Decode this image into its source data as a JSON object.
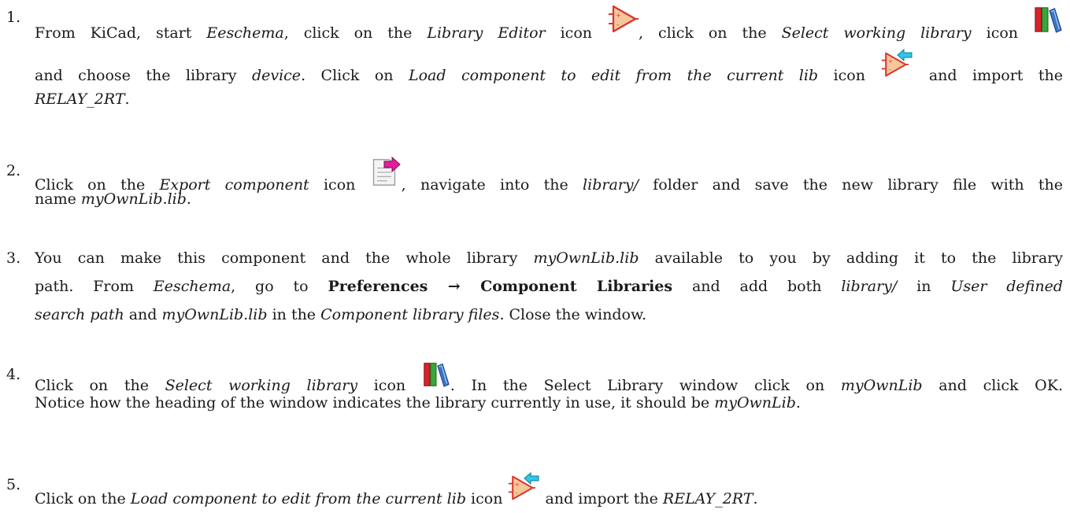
{
  "steps": [
    {
      "num": "1.",
      "t1": "From KiCad, start ",
      "eeschema": "Eeschema",
      "t2": ", click on the ",
      "library_editor": "Library Editor",
      "t3": " icon ",
      "t4": ", click on the ",
      "select_working_library": "Select working library",
      "t5": " icon",
      "t6": "and choose the library ",
      "device": "device",
      "t7": ". Click on ",
      "load_component": "Load component to edit from the current lib",
      "t8": " icon ",
      "t9": " and import the",
      "relay": "RELAY_2RT",
      "t10": "."
    },
    {
      "num": "2.",
      "t1": "Click on the ",
      "export_component": "Export component",
      "t2": " icon ",
      "t3": ", navigate into the ",
      "library_folder": "library/",
      "t4": " folder and save the new library file with the",
      "t5": "name ",
      "mylib": "myOwnLib.lib",
      "t6": "."
    },
    {
      "num": "3.",
      "t1": "You can make this component and the whole library ",
      "mylib": "myOwnLib.lib",
      "t2": " available to you by adding it to the library",
      "t3": "path. From ",
      "eeschema": "Eeschema",
      "t4": ", go to ",
      "menu_path": "Preferences → Component Libraries",
      "t5": " and add both ",
      "library_folder": "library/",
      "t6": " in ",
      "user_defined": "User defined",
      "search_path": "search path",
      "t7": " and ",
      "mylib2": "myOwnLib.lib",
      "t8": " in the ",
      "component_library_files": "Component library files",
      "t9": ". Close the window."
    },
    {
      "num": "4.",
      "t1": "Click on the ",
      "select_working_library": "Select working library",
      "t2": " icon ",
      "t3": ". In the Select Library window click on ",
      "mylib": "myOwnLib",
      "t4": " and click OK.",
      "t5": "Notice how the heading of the window indicates the library currently in use, it should be ",
      "mylib2": "myOwnLib",
      "t6": "."
    },
    {
      "num": "5.",
      "t1": "Click on the ",
      "load_component": "Load component to edit from the current lib",
      "t2": " icon ",
      "t3": " and import the ",
      "relay": "RELAY_2RT",
      "t4": "."
    }
  ],
  "icons": {
    "library_editor": "library-editor-icon",
    "select_working_library": "select-working-library-icon",
    "load_component": "load-component-icon",
    "export_component": "export-component-icon"
  },
  "colors": {
    "component_fill": "#f5c79a",
    "component_stroke": "#d9342b",
    "arrow_cyan": "#2ec8e8",
    "arrow_magenta": "#e0209a",
    "book_red": "#d8232a",
    "book_green": "#3aa53a",
    "book_blue": "#3b74c8"
  }
}
